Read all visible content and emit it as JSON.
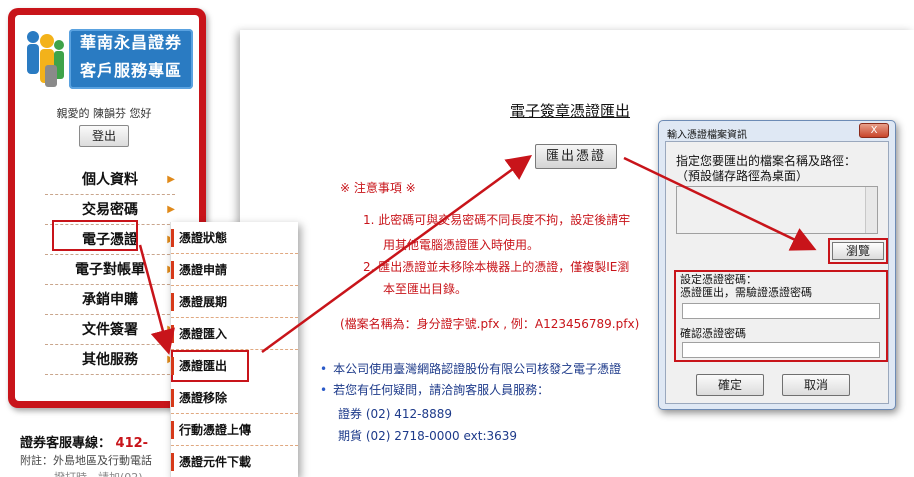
{
  "brand": {
    "line1": "華南永昌證券",
    "line2": "客戶服務專區"
  },
  "user": {
    "greeting": "親愛的 陳韻芬 您好",
    "logout_label": "登出"
  },
  "menu": {
    "items": [
      {
        "label": "個人資料"
      },
      {
        "label": "交易密碼"
      },
      {
        "label": "電子憑證"
      },
      {
        "label": "電子對帳單"
      },
      {
        "label": "承銷申購"
      },
      {
        "label": "文件簽署"
      },
      {
        "label": "其他服務"
      }
    ]
  },
  "submenu": {
    "items": [
      {
        "label": "憑證狀態"
      },
      {
        "label": "憑證申請"
      },
      {
        "label": "憑證展期"
      },
      {
        "label": "憑證匯入"
      },
      {
        "label": "憑證匯出"
      },
      {
        "label": "憑證移除"
      },
      {
        "label": "行動憑證上傳"
      },
      {
        "label": "憑證元件下載"
      }
    ]
  },
  "footer": {
    "hotline_label": "證券客服專線：",
    "hotline_number": "412-",
    "note_line1": "附註：外島地區及行動電話",
    "note_line2": "撥打時，請加(02)"
  },
  "main": {
    "title": "電子簽章憑證匯出",
    "export_button": "匯出憑證",
    "notes_heading": "※ 注意事項 ※",
    "note1_line1": "1.  此密碼可與交易密碼不同長度不拘，設定後請牢",
    "note1_line2": "用其他電腦憑證匯入時使用。",
    "note2_line1": "2.  匯出憑證並未移除本機器上的憑證，僅複製IE瀏",
    "note2_line2": "本至匯出目錄。",
    "file_example": "(檔案名稱為：身分證字號.pfx , 例：A123456789.pfx)",
    "bullet1": "本公司使用臺灣網路認證股份有限公司核發之電子憑證",
    "bullet2": "若您有任何疑問，請洽詢客服人員服務：",
    "contact_securities": "證券 (02) 412-8889",
    "contact_futures": "期貨 (02) 2718-0000 ext:3639"
  },
  "dialog": {
    "title": "輸入憑證檔案資訊",
    "close_label": "X",
    "prompt_line1": "指定您要匯出的檔案名稱及路徑：",
    "prompt_line2": "（預設儲存路徑為桌面）",
    "browse_label": "瀏覽",
    "set_password_label": "設定憑證密碼：",
    "password_hint": "憑證匯出，需驗證憑證密碼",
    "confirm_password_label": "確認憑證密碼",
    "ok_label": "確定",
    "cancel_label": "取消"
  },
  "colors": {
    "brand_red": "#c8141a",
    "brand_blue": "#2a7bc2",
    "note_red": "#c8141a",
    "link_blue": "#1d3a8a"
  }
}
